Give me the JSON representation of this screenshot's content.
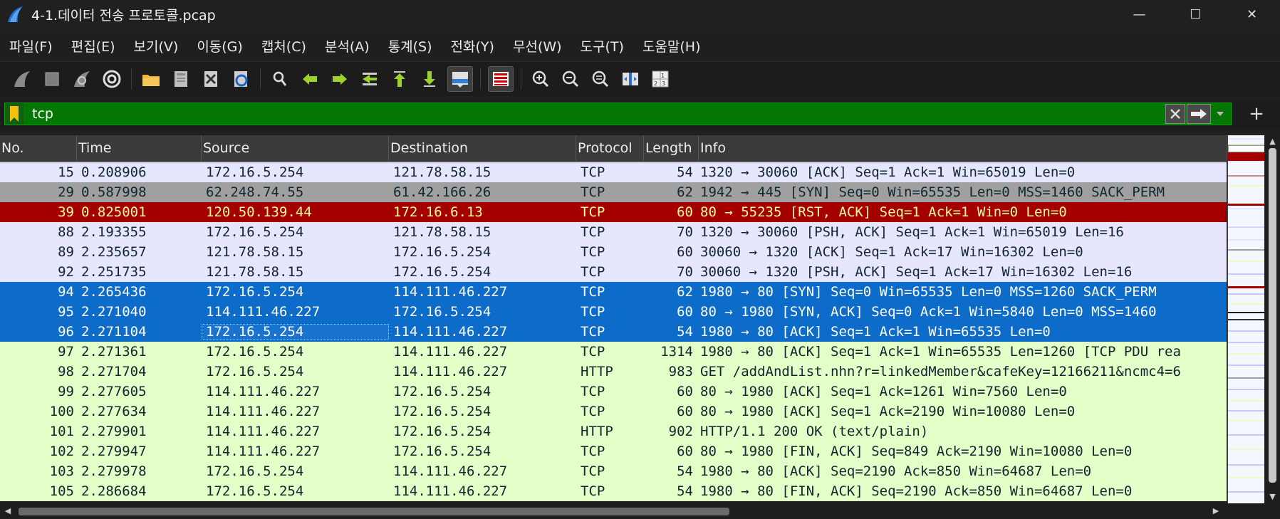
{
  "window": {
    "title": "4-1.데이터 전송 프로토콜.pcap",
    "icon": "wireshark-fin-icon",
    "controls": {
      "minimize": "—",
      "maximize": "☐",
      "close": "✕"
    }
  },
  "menu": [
    {
      "label": "파일(F)"
    },
    {
      "label": "편집(E)"
    },
    {
      "label": "보기(V)"
    },
    {
      "label": "이동(G)"
    },
    {
      "label": "캡처(C)"
    },
    {
      "label": "분석(A)"
    },
    {
      "label": "통계(S)"
    },
    {
      "label": "전화(Y)"
    },
    {
      "label": "무선(W)"
    },
    {
      "label": "도구(T)"
    },
    {
      "label": "도움말(H)"
    }
  ],
  "toolbar": {
    "buttons": [
      "start-capture-icon",
      "stop-capture-icon",
      "restart-capture-icon",
      "capture-options-icon",
      "open-file-icon",
      "save-file-icon",
      "close-file-icon",
      "reload-file-icon",
      "find-packet-icon",
      "go-back-icon",
      "go-forward-icon",
      "go-to-packet-icon",
      "go-first-icon",
      "go-last-icon",
      "autoscroll-icon",
      "colorize-icon",
      "zoom-in-icon",
      "zoom-out-icon",
      "zoom-normal-icon",
      "resize-columns-icon",
      "expand-subtrees-icon"
    ],
    "active": [
      "autoscroll-icon",
      "colorize-icon"
    ]
  },
  "filter": {
    "value": "tcp",
    "color": "#047604",
    "add_label": "+"
  },
  "columns": [
    {
      "key": "no",
      "label": "No."
    },
    {
      "key": "time",
      "label": "Time"
    },
    {
      "key": "source",
      "label": "Source"
    },
    {
      "key": "destination",
      "label": "Destination"
    },
    {
      "key": "protocol",
      "label": "Protocol"
    },
    {
      "key": "length",
      "label": "Length"
    },
    {
      "key": "info",
      "label": "Info"
    }
  ],
  "packets": [
    {
      "no": "15",
      "time": "0.208906",
      "source": "172.16.5.254",
      "destination": "121.78.58.15",
      "protocol": "TCP",
      "length": "54",
      "info": "1320 → 30060 [ACK] Seq=1 Ack=1 Win=65019 Len=0",
      "style": "tcp"
    },
    {
      "no": "29",
      "time": "0.587998",
      "source": "62.248.74.55",
      "destination": "61.42.166.26",
      "protocol": "TCP",
      "length": "62",
      "info": "1942 → 445 [SYN] Seq=0 Win=65535 Len=0 MSS=1460 SACK_PERM",
      "style": "gray"
    },
    {
      "no": "39",
      "time": "0.825001",
      "source": "120.50.139.44",
      "destination": "172.16.6.13",
      "protocol": "TCP",
      "length": "60",
      "info": "80 → 55235 [RST, ACK] Seq=1 Ack=1 Win=0 Len=0",
      "style": "rst"
    },
    {
      "no": "88",
      "time": "2.193355",
      "source": "172.16.5.254",
      "destination": "121.78.58.15",
      "protocol": "TCP",
      "length": "70",
      "info": "1320 → 30060 [PSH, ACK] Seq=1 Ack=1 Win=65019 Len=16",
      "style": "tcp"
    },
    {
      "no": "89",
      "time": "2.235657",
      "source": "121.78.58.15",
      "destination": "172.16.5.254",
      "protocol": "TCP",
      "length": "60",
      "info": "30060 → 1320 [ACK] Seq=1 Ack=17 Win=16302 Len=0",
      "style": "tcp"
    },
    {
      "no": "92",
      "time": "2.251735",
      "source": "121.78.58.15",
      "destination": "172.16.5.254",
      "protocol": "TCP",
      "length": "70",
      "info": "30060 → 1320 [PSH, ACK] Seq=1 Ack=17 Win=16302 Len=16",
      "style": "tcp"
    },
    {
      "no": "94",
      "time": "2.265436",
      "source": "172.16.5.254",
      "destination": "114.111.46.227",
      "protocol": "TCP",
      "length": "62",
      "info": "1980 → 80 [SYN] Seq=0 Win=65535 Len=0 MSS=1260 SACK_PERM",
      "style": "sel"
    },
    {
      "no": "95",
      "time": "2.271040",
      "source": "114.111.46.227",
      "destination": "172.16.5.254",
      "protocol": "TCP",
      "length": "60",
      "info": "80 → 1980 [SYN, ACK] Seq=0 Ack=1 Win=5840 Len=0 MSS=1460",
      "style": "sel"
    },
    {
      "no": "96",
      "time": "2.271104",
      "source": "172.16.5.254",
      "destination": "114.111.46.227",
      "protocol": "TCP",
      "length": "54",
      "info": "1980 → 80 [ACK] Seq=1 Ack=1 Win=65535 Len=0",
      "style": "sel",
      "focus": "source"
    },
    {
      "no": "97",
      "time": "2.271361",
      "source": "172.16.5.254",
      "destination": "114.111.46.227",
      "protocol": "TCP",
      "length": "1314",
      "info": "1980 → 80 [ACK] Seq=1 Ack=1 Win=65535 Len=1260 [TCP PDU rea",
      "style": "http"
    },
    {
      "no": "98",
      "time": "2.271704",
      "source": "172.16.5.254",
      "destination": "114.111.46.227",
      "protocol": "HTTP",
      "length": "983",
      "info": "GET /addAndList.nhn?r=linkedMember&cafeKey=12166211&ncmc4=6",
      "style": "http"
    },
    {
      "no": "99",
      "time": "2.277605",
      "source": "114.111.46.227",
      "destination": "172.16.5.254",
      "protocol": "TCP",
      "length": "60",
      "info": "80 → 1980 [ACK] Seq=1 Ack=1261 Win=7560 Len=0",
      "style": "http"
    },
    {
      "no": "100",
      "time": "2.277634",
      "source": "114.111.46.227",
      "destination": "172.16.5.254",
      "protocol": "TCP",
      "length": "60",
      "info": "80 → 1980 [ACK] Seq=1 Ack=2190 Win=10080 Len=0",
      "style": "http"
    },
    {
      "no": "101",
      "time": "2.279901",
      "source": "114.111.46.227",
      "destination": "172.16.5.254",
      "protocol": "HTTP",
      "length": "902",
      "info": "HTTP/1.1 200 OK  (text/plain)",
      "style": "http"
    },
    {
      "no": "102",
      "time": "2.279947",
      "source": "114.111.46.227",
      "destination": "172.16.5.254",
      "protocol": "TCP",
      "length": "60",
      "info": "80 → 1980 [FIN, ACK] Seq=849 Ack=2190 Win=10080 Len=0",
      "style": "http"
    },
    {
      "no": "103",
      "time": "2.279978",
      "source": "172.16.5.254",
      "destination": "114.111.46.227",
      "protocol": "TCP",
      "length": "54",
      "info": "1980 → 80 [ACK] Seq=2190 Ack=850 Win=64687 Len=0",
      "style": "http"
    },
    {
      "no": "105",
      "time": "2.286684",
      "source": "172.16.5.254",
      "destination": "114.111.46.227",
      "protocol": "TCP",
      "length": "54",
      "info": "1980 → 80 [FIN, ACK] Seq=2190 Ack=850 Win=64687 Len=0",
      "style": "http"
    }
  ],
  "colors": {
    "tcp": "#e7e6ff",
    "bad_tcp": "#a40000",
    "selected": "#0d6bc9",
    "http": "#e4ffc7",
    "syn_gray": "#a0a0a0"
  }
}
